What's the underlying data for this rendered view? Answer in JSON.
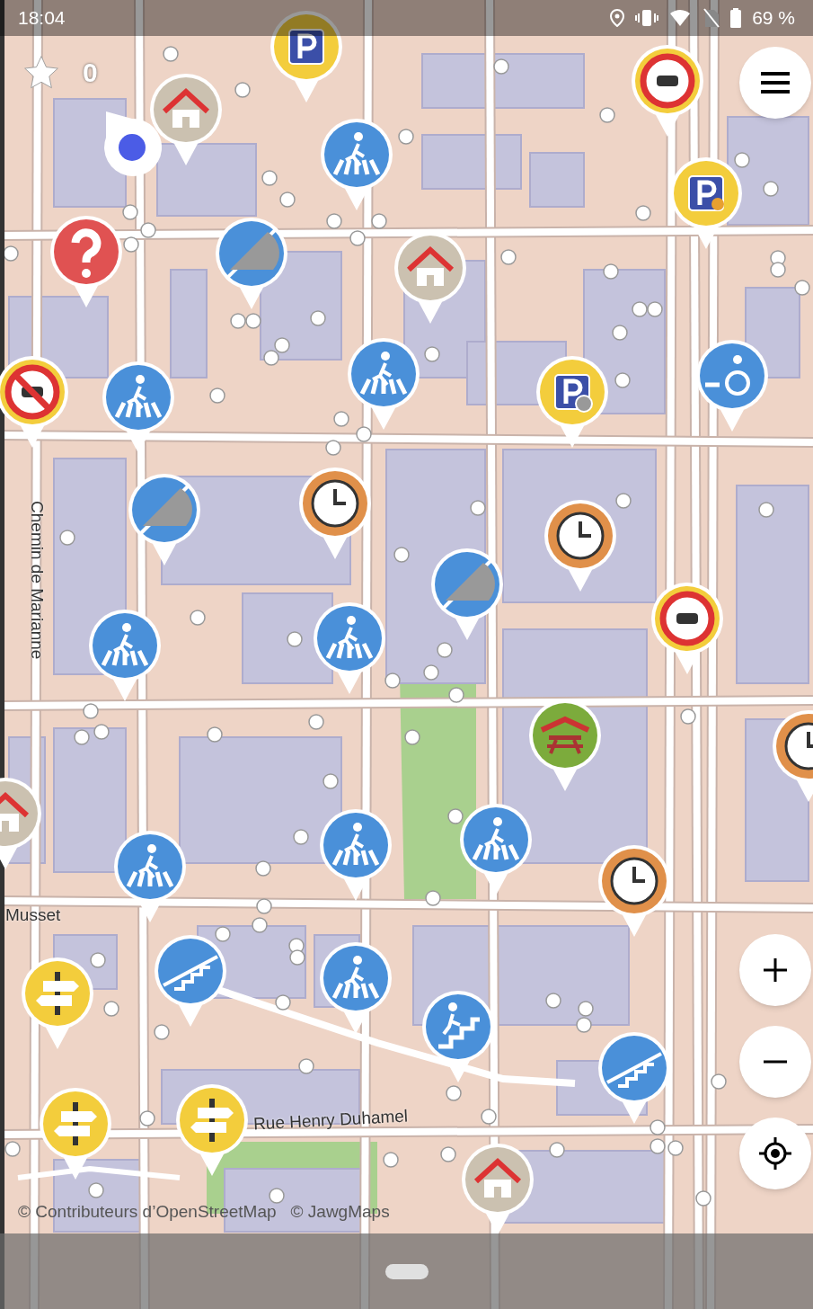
{
  "status_bar": {
    "time": "18:04",
    "battery": "69 %"
  },
  "star_counter": {
    "count": "0"
  },
  "map": {
    "street_labels": [
      {
        "text": "Chemin de Marianne",
        "kind": "vertical"
      },
      {
        "text": "Musset",
        "kind": "horizontal"
      },
      {
        "text": "Rue Henry Duhamel",
        "kind": "horizontal"
      }
    ],
    "attribution": [
      "© Contributeurs d’OpenStreetMap",
      "© JawgMaps"
    ]
  }
}
